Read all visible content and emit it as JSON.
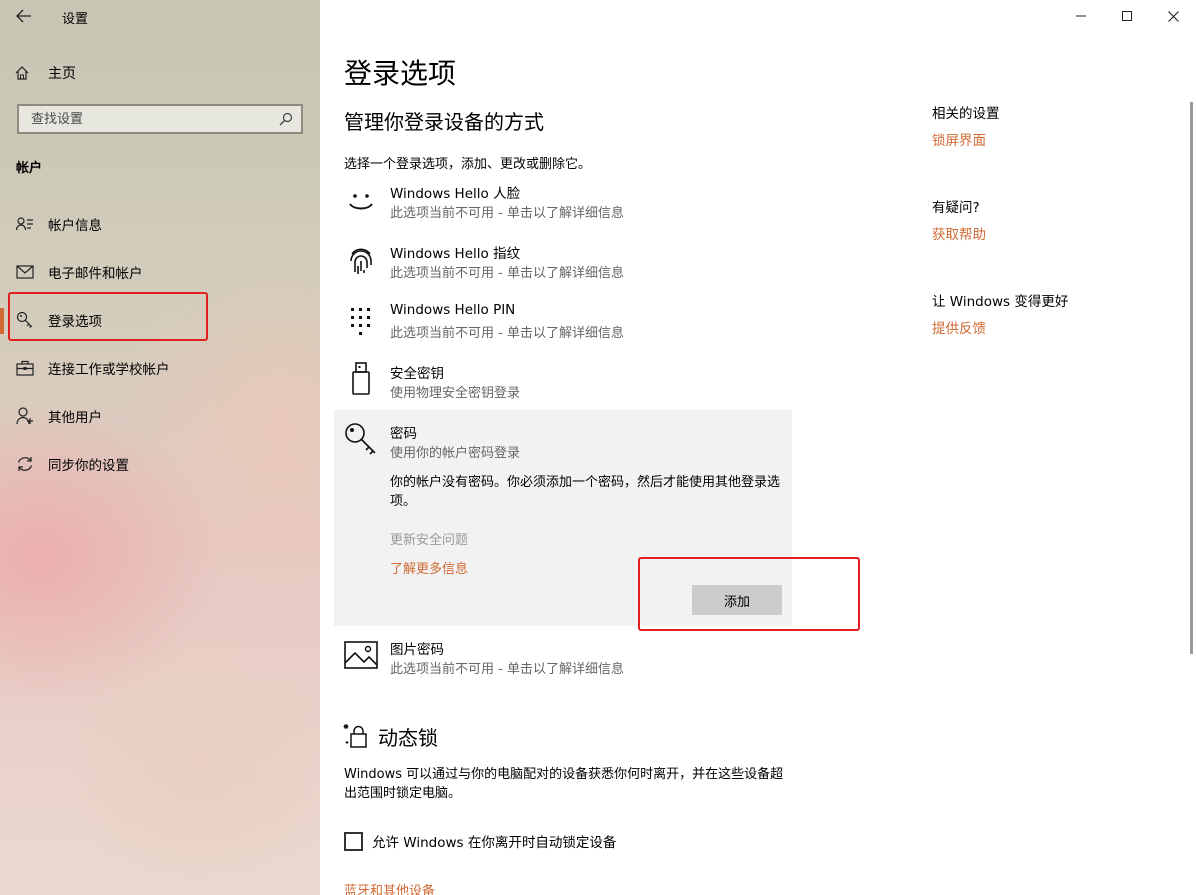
{
  "window": {
    "title": "设置",
    "controls": [
      "minimize",
      "maximize",
      "close"
    ]
  },
  "sidebar": {
    "home_label": "主页",
    "search_placeholder": "查找设置",
    "section_label": "帐户",
    "items": [
      {
        "label": "帐户信息",
        "icon": "person-info-icon"
      },
      {
        "label": "电子邮件和帐户",
        "icon": "mail-icon"
      },
      {
        "label": "登录选项",
        "icon": "key-icon",
        "selected": true
      },
      {
        "label": "连接工作或学校帐户",
        "icon": "briefcase-icon"
      },
      {
        "label": "其他用户",
        "icon": "person-add-icon"
      },
      {
        "label": "同步你的设置",
        "icon": "sync-icon"
      }
    ]
  },
  "main": {
    "title": "登录选项",
    "subheading": "管理你登录设备的方式",
    "intro": "选择一个登录选项，添加、更改或删除它。",
    "options": [
      {
        "title": "Windows Hello 人脸",
        "subtitle": "此选项当前不可用 - 单击以了解详细信息",
        "icon": "face-icon"
      },
      {
        "title": "Windows Hello 指纹",
        "subtitle": "此选项当前不可用 - 单击以了解详细信息",
        "icon": "fingerprint-icon"
      },
      {
        "title": "Windows Hello PIN",
        "subtitle": "此选项当前不可用 - 单击以了解详细信息",
        "icon": "pin-keypad-icon"
      },
      {
        "title": "安全密钥",
        "subtitle": "使用物理安全密钥登录",
        "icon": "usb-key-icon"
      }
    ],
    "password": {
      "title": "密码",
      "subtitle": "使用你的帐户密码登录",
      "message": "你的帐户没有密码。你必须添加一个密码，然后才能使用其他登录选项。",
      "update_label": "更新安全问题",
      "learn_more_label": "了解更多信息",
      "add_button": "添加",
      "icon": "password-key-icon"
    },
    "picture_password": {
      "title": "图片密码",
      "subtitle": "此选项当前不可用 - 单击以了解详细信息",
      "icon": "picture-icon"
    },
    "dynamic_lock": {
      "title": "动态锁",
      "description": "Windows 可以通过与你的电脑配对的设备获悉你何时离开，并在这些设备超出范围时锁定电脑。",
      "checkbox_label": "允许 Windows 在你离开时自动锁定设备",
      "checked": false,
      "bluetooth_link": "蓝牙和其他设备",
      "icon": "dynamic-lock-icon"
    }
  },
  "related": {
    "related_heading": "相关的设置",
    "related_link": "锁屏界面",
    "question_heading": "有疑问?",
    "help_link": "获取帮助",
    "feedback_heading": "让 Windows 变得更好",
    "feedback_link": "提供反馈"
  },
  "colors": {
    "accent": "#d16a34",
    "highlight_box": "#e02020",
    "panel_bg": "#f2f2f2",
    "button_bg": "#cccccc"
  }
}
